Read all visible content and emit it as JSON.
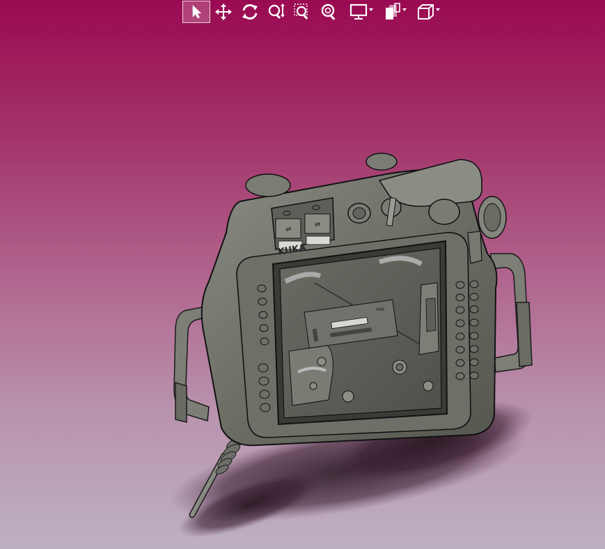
{
  "toolbar": {
    "tools": [
      {
        "id": "select",
        "icon": "cursor-arrow-icon",
        "active": true
      },
      {
        "id": "pan",
        "icon": "move-arrows-icon"
      },
      {
        "id": "rotate",
        "icon": "rotate-icon"
      },
      {
        "id": "zoom-dynamic",
        "icon": "zoom-updown-icon"
      },
      {
        "id": "zoom-window",
        "icon": "zoom-window-icon"
      },
      {
        "id": "zoom-fit",
        "icon": "zoom-fit-icon"
      },
      {
        "id": "display-style",
        "icon": "monitor-icon",
        "dropdown": true
      },
      {
        "id": "section-view",
        "icon": "section-sheets-icon",
        "dropdown": true
      },
      {
        "id": "view-orientation",
        "icon": "cube-icon",
        "dropdown": true
      }
    ]
  },
  "model": {
    "brand_label": "KUKA",
    "small_label": "ABB",
    "colors": {
      "body": "#6c6e65",
      "body_light": "#858780",
      "screen": "#5a5c55",
      "edge": "#1a1a1a",
      "shadow": "#2a1a26"
    }
  }
}
